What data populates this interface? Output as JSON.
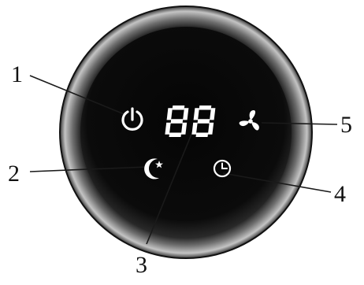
{
  "diagram": {
    "display_value": "88",
    "callouts": [
      {
        "number": "1",
        "target": "power-button"
      },
      {
        "number": "2",
        "target": "sleep-mode-button"
      },
      {
        "number": "3",
        "target": "led-display"
      },
      {
        "number": "4",
        "target": "timer-button"
      },
      {
        "number": "5",
        "target": "fan-speed-button"
      }
    ],
    "icons": {
      "power": "power-icon",
      "sleep": "moon-star-icon",
      "timer": "clock-icon",
      "fan": "fan-icon"
    },
    "colors": {
      "panel_face": "#0a0a0a",
      "bezel_dark": "#1f1f1f",
      "bezel_light": "#9a9a9a",
      "icon": "#ffffff"
    }
  }
}
